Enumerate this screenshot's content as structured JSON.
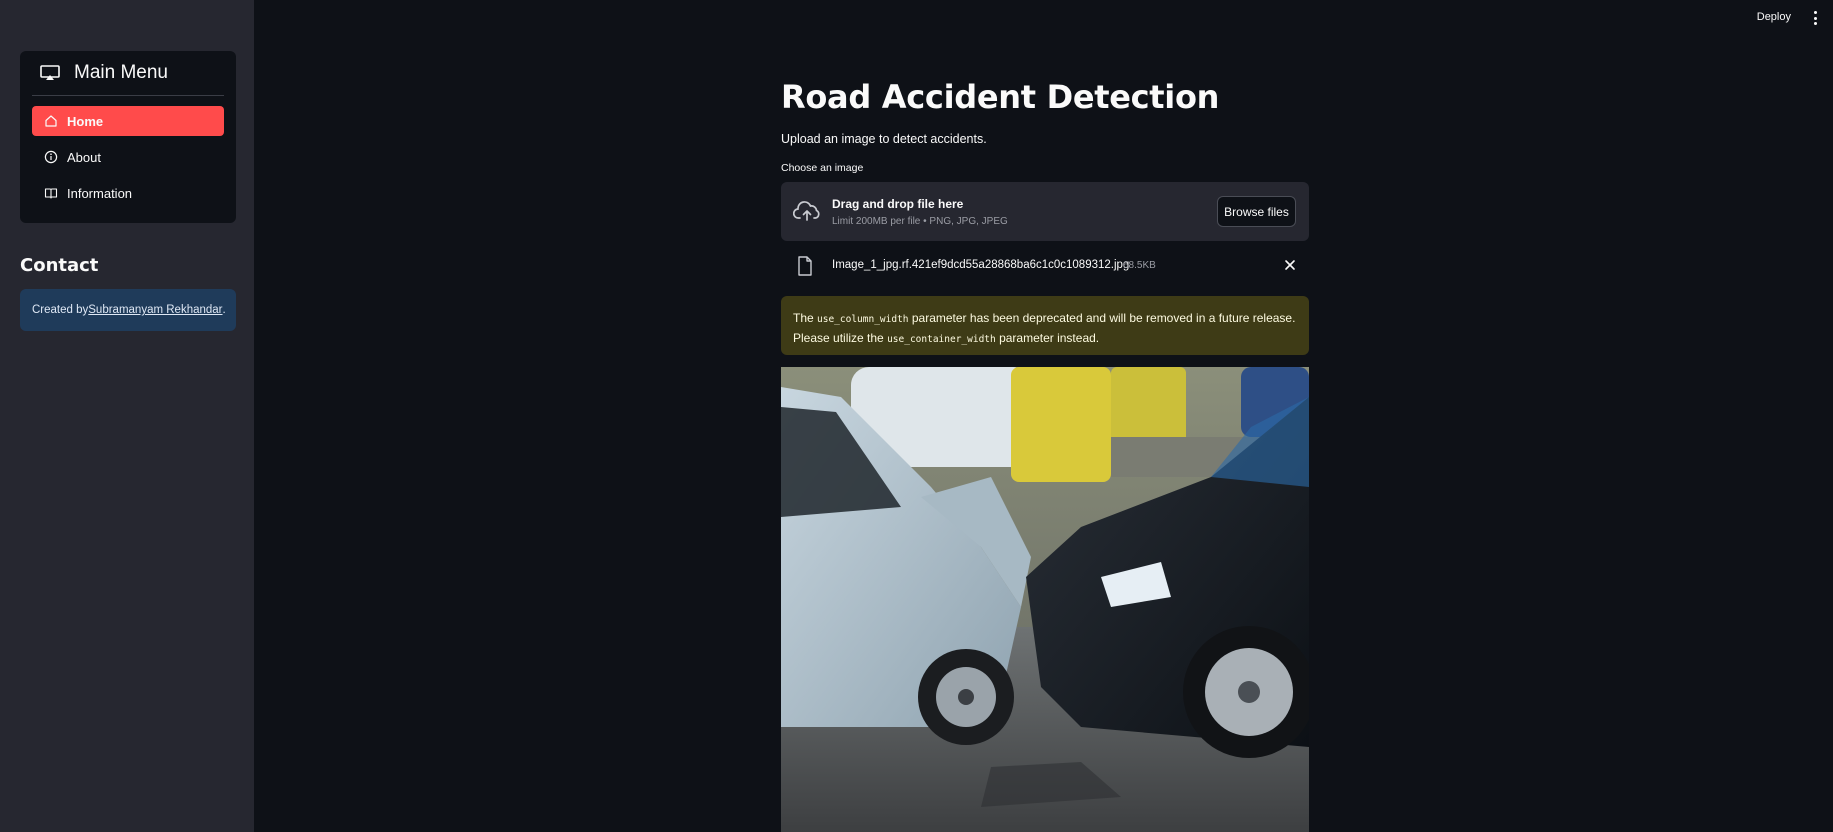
{
  "header": {
    "deploy_label": "Deploy"
  },
  "sidebar": {
    "menu_title": "Main Menu",
    "items": [
      {
        "label": "Home",
        "active": true,
        "icon": "house-icon"
      },
      {
        "label": "About",
        "active": false,
        "icon": "info-circle-icon"
      },
      {
        "label": "Information",
        "active": false,
        "icon": "book-icon"
      }
    ],
    "contact_title": "Contact",
    "contact_prefix": "Created by ",
    "contact_name": "Subramanyam Rekhandar",
    "contact_suffix": "."
  },
  "main": {
    "title": "Road Accident Detection",
    "subtitle": "Upload an image to detect accidents.",
    "uploader": {
      "label": "Choose an image",
      "drop_text": "Drag and drop file here",
      "limit_text": "Limit 200MB per file • PNG, JPG, JPEG",
      "browse_label": "Browse files"
    },
    "file": {
      "name": "Image_1_jpg.rf.421ef9dcd55a28868ba6c1c0c1089312.jpg",
      "size": "68.5KB"
    },
    "warning": {
      "t1": "The ",
      "code1": "use_column_width",
      "t2": " parameter has been deprecated and will be removed in a future release. Please utilize the ",
      "code2": "use_container_width",
      "t3": " parameter instead."
    }
  },
  "colors": {
    "background": "#0e1117",
    "sidebar": "#262730",
    "accent": "#ff4b4b",
    "warning_bg": "#3e3b16",
    "info_bg": "#1f3b5a"
  }
}
